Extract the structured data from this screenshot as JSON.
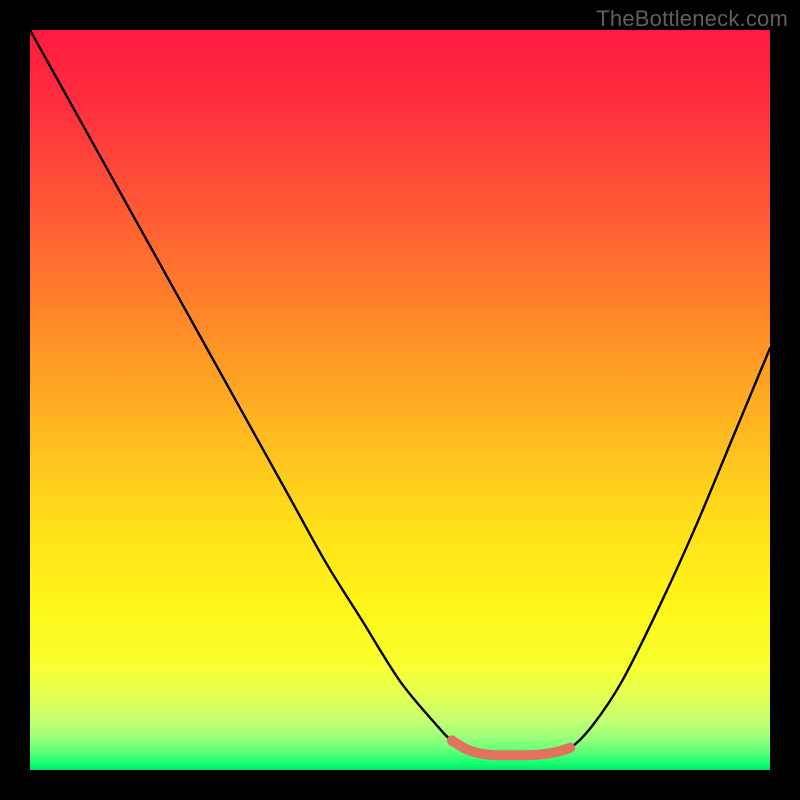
{
  "watermark": "TheBottleneck.com",
  "gradient_stops": [
    {
      "offset": 0.0,
      "color": "#ff1a3f"
    },
    {
      "offset": 0.1,
      "color": "#ff2e3e"
    },
    {
      "offset": 0.25,
      "color": "#ff5b34"
    },
    {
      "offset": 0.4,
      "color": "#ff8b28"
    },
    {
      "offset": 0.55,
      "color": "#ffbb1f"
    },
    {
      "offset": 0.68,
      "color": "#ffe21a"
    },
    {
      "offset": 0.78,
      "color": "#fff617"
    },
    {
      "offset": 0.86,
      "color": "#f7ff30"
    },
    {
      "offset": 0.9,
      "color": "#e4ff55"
    },
    {
      "offset": 0.93,
      "color": "#c8ff6e"
    },
    {
      "offset": 0.955,
      "color": "#9dff7a"
    },
    {
      "offset": 0.975,
      "color": "#5fff78"
    },
    {
      "offset": 0.99,
      "color": "#1aff73"
    },
    {
      "offset": 1.0,
      "color": "#00e667"
    }
  ],
  "chart_data": {
    "type": "line",
    "title": "",
    "xlabel": "",
    "ylabel": "",
    "xlim": [
      0,
      100
    ],
    "ylim": [
      0,
      100
    ],
    "grid": false,
    "series": [
      {
        "name": "bottleneck-curve",
        "color": "#000000",
        "x": [
          0,
          5,
          10,
          15,
          20,
          25,
          30,
          35,
          40,
          45,
          50,
          55,
          57,
          60,
          65,
          67,
          70,
          73,
          76,
          80,
          85,
          90,
          95,
          100
        ],
        "y": [
          100,
          91,
          82,
          73,
          64,
          55,
          46,
          37,
          28,
          20,
          12,
          6,
          4,
          2.3,
          2.0,
          2.0,
          2.2,
          3,
          6,
          12,
          22,
          33,
          45,
          57
        ]
      },
      {
        "name": "optimal-segment",
        "color": "#e2725b",
        "x": [
          57,
          59,
          61,
          63,
          65,
          67,
          69,
          71,
          73
        ],
        "y": [
          4,
          2.8,
          2.2,
          2.0,
          2.0,
          2.0,
          2.1,
          2.4,
          3
        ]
      }
    ]
  }
}
